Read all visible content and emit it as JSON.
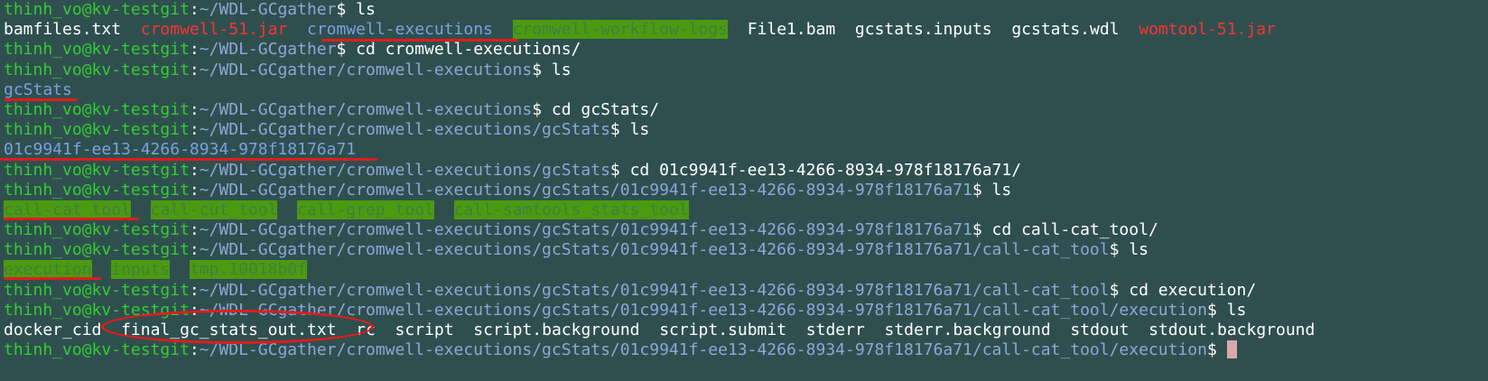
{
  "terminal": {
    "user_host": "thinh_vo@kv-testgit",
    "lines": [
      {
        "type": "prompt",
        "path": "~/WDL-GCgather",
        "cmd": " ls"
      },
      {
        "type": "ls",
        "items": [
          {
            "text": "bamfiles.txt",
            "kind": "file"
          },
          {
            "text": "cromwell-51.jar",
            "kind": "jar"
          },
          {
            "text": "cromwell-executions",
            "kind": "dir"
          },
          {
            "text": "cromwell-workflow-logs",
            "kind": "dir-green"
          },
          {
            "text": "File1.bam",
            "kind": "file"
          },
          {
            "text": "gcstats.inputs",
            "kind": "file"
          },
          {
            "text": "gcstats.wdl",
            "kind": "file"
          },
          {
            "text": "womtool-51.jar",
            "kind": "jar"
          }
        ]
      },
      {
        "type": "prompt",
        "path": "~/WDL-GCgather",
        "cmd": " cd cromwell-executions/"
      },
      {
        "type": "prompt",
        "path": "~/WDL-GCgather/cromwell-executions",
        "cmd": " ls"
      },
      {
        "type": "ls",
        "items": [
          {
            "text": "gcStats",
            "kind": "dir"
          }
        ]
      },
      {
        "type": "prompt",
        "path": "~/WDL-GCgather/cromwell-executions",
        "cmd": " cd gcStats/"
      },
      {
        "type": "prompt",
        "path": "~/WDL-GCgather/cromwell-executions/gcStats",
        "cmd": " ls"
      },
      {
        "type": "ls",
        "items": [
          {
            "text": "01c9941f-ee13-4266-8934-978f18176a71",
            "kind": "dir"
          }
        ]
      },
      {
        "type": "prompt",
        "path": "~/WDL-GCgather/cromwell-executions/gcStats",
        "cmd": " cd 01c9941f-ee13-4266-8934-978f18176a71/"
      },
      {
        "type": "prompt",
        "path": "~/WDL-GCgather/cromwell-executions/gcStats/01c9941f-ee13-4266-8934-978f18176a71",
        "cmd": " ls"
      },
      {
        "type": "ls",
        "items": [
          {
            "text": "call-cat_tool",
            "kind": "dir-green"
          },
          {
            "text": "call-cut_tool",
            "kind": "dir-green"
          },
          {
            "text": "call-grep_tool",
            "kind": "dir-green"
          },
          {
            "text": "call-samtools_stats_tool",
            "kind": "dir-green"
          }
        ]
      },
      {
        "type": "prompt",
        "path": "~/WDL-GCgather/cromwell-executions/gcStats/01c9941f-ee13-4266-8934-978f18176a71",
        "cmd": " cd call-cat_tool/"
      },
      {
        "type": "prompt",
        "path": "~/WDL-GCgather/cromwell-executions/gcStats/01c9941f-ee13-4266-8934-978f18176a71/call-cat_tool",
        "cmd": " ls"
      },
      {
        "type": "ls",
        "items": [
          {
            "text": "execution",
            "kind": "dir-green"
          },
          {
            "text": "inputs",
            "kind": "dir-green"
          },
          {
            "text": "tmp.10018b0f",
            "kind": "dir-green"
          }
        ]
      },
      {
        "type": "prompt",
        "path": "~/WDL-GCgather/cromwell-executions/gcStats/01c9941f-ee13-4266-8934-978f18176a71/call-cat_tool",
        "cmd": " cd execution/"
      },
      {
        "type": "prompt",
        "path": "~/WDL-GCgather/cromwell-executions/gcStats/01c9941f-ee13-4266-8934-978f18176a71/call-cat_tool/execution",
        "cmd": " ls"
      },
      {
        "type": "ls",
        "items": [
          {
            "text": "docker_cid",
            "kind": "file"
          },
          {
            "text": "final_gc_stats_out.txt",
            "kind": "file"
          },
          {
            "text": "rc",
            "kind": "file"
          },
          {
            "text": "script",
            "kind": "file"
          },
          {
            "text": "script.background",
            "kind": "file"
          },
          {
            "text": "script.submit",
            "kind": "file"
          },
          {
            "text": "stderr",
            "kind": "file"
          },
          {
            "text": "stderr.background",
            "kind": "file"
          },
          {
            "text": "stdout",
            "kind": "file"
          },
          {
            "text": "stdout.background",
            "kind": "file"
          }
        ]
      },
      {
        "type": "prompt",
        "path": "~/WDL-GCgather/cromwell-executions/gcStats/01c9941f-ee13-4266-8934-978f18176a71/call-cat_tool/execution",
        "cmd": " ",
        "cursor": true
      }
    ]
  },
  "colors": {
    "background": "#2f4f4f",
    "user": "#33cc33",
    "path": "#8aa8d8",
    "jar": "#ff3333",
    "dir": "#7aa0e0",
    "annotation": "#e31b1b"
  }
}
